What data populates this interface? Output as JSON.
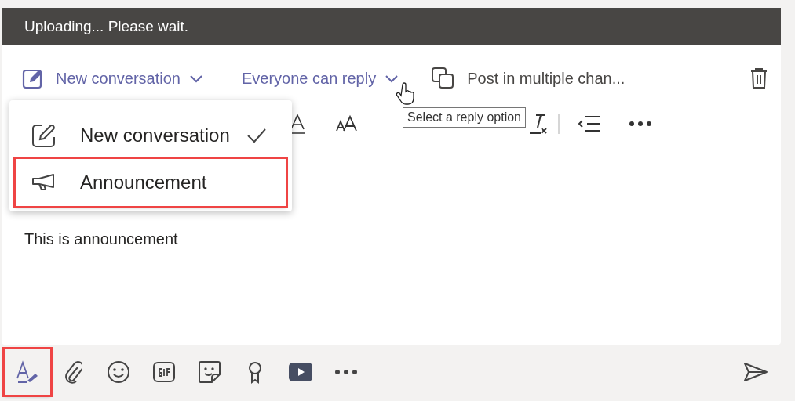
{
  "banner": {
    "text": "Uploading... Please wait."
  },
  "header": {
    "post_type": {
      "label": "New conversation"
    },
    "reply_option": {
      "label": "Everyone can reply"
    },
    "multi_channel": {
      "label": "Post in multiple chan..."
    }
  },
  "tooltip": {
    "text": "Select a reply option"
  },
  "post_type_menu": [
    {
      "kind": "conversation",
      "label": "New conversation",
      "selected": true,
      "annotated": false
    },
    {
      "kind": "announcement",
      "label": "Announcement",
      "selected": false,
      "annotated": true
    }
  ],
  "format_toolbar": [
    {
      "kind": "font-color"
    },
    {
      "kind": "font-size"
    },
    {
      "kind": "clear-format"
    },
    {
      "kind": "divider"
    },
    {
      "kind": "outdent"
    },
    {
      "kind": "more"
    }
  ],
  "message": {
    "text": "This is announcement"
  },
  "compose_toolbar": [
    {
      "kind": "format",
      "annotated": true
    },
    {
      "kind": "attach",
      "annotated": false
    },
    {
      "kind": "emoji",
      "annotated": false
    },
    {
      "kind": "gif",
      "annotated": false
    },
    {
      "kind": "sticker",
      "annotated": false
    },
    {
      "kind": "praise",
      "annotated": false
    },
    {
      "kind": "video",
      "annotated": false
    },
    {
      "kind": "more",
      "annotated": false
    }
  ]
}
